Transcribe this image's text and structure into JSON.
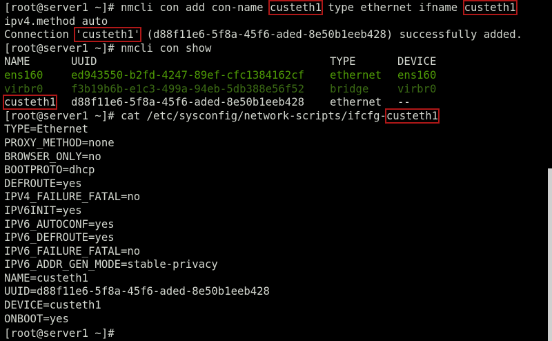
{
  "prompt": "[root@server1 ~]#",
  "cmd1": {
    "pre": " nmcli con add con-name ",
    "arg1": "custeth1",
    "mid": " type ethernet ifname ",
    "arg2": "custeth1",
    "cont": "ipv4.method auto"
  },
  "result1": {
    "pre": "Connection ",
    "name": "'custeth1'",
    "post": " (d88f11e6-5f8a-45f6-aded-8e50b1eeb428) successfully added."
  },
  "cmd2": " nmcli con show",
  "table": {
    "headers": [
      "NAME",
      "UUID",
      "TYPE",
      "DEVICE"
    ],
    "rows": [
      {
        "name": "ens160",
        "uuid": "ed943550-b2fd-4247-89ef-cfc1384162cf",
        "type": "ethernet",
        "device": "ens160"
      },
      {
        "name": "virbr0",
        "uuid": "f3b19b6b-e1c3-499a-94eb-5db388e56f52",
        "type": "bridge",
        "device": "virbr0"
      },
      {
        "name": "custeth1",
        "uuid": "d88f11e6-5f8a-45f6-aded-8e50b1eeb428",
        "type": "ethernet",
        "device": "--"
      }
    ]
  },
  "cmd3": {
    "pre": " cat /etc/sysconfig/network-scripts/ifcfg-",
    "arg": "custeth1"
  },
  "ifcfg": [
    "TYPE=Ethernet",
    "PROXY_METHOD=none",
    "BROWSER_ONLY=no",
    "BOOTPROTO=dhcp",
    "DEFROUTE=yes",
    "IPV4_FAILURE_FATAL=no",
    "IPV6INIT=yes",
    "IPV6_AUTOCONF=yes",
    "IPV6_DEFROUTE=yes",
    "IPV6_FAILURE_FATAL=no",
    "IPV6_ADDR_GEN_MODE=stable-privacy",
    "NAME=custeth1",
    "UUID=d88f11e6-5f8a-45f6-aded-8e50b1eeb428",
    "DEVICE=custeth1",
    "ONBOOT=yes"
  ],
  "colors": {
    "background": "#000000",
    "text": "#d3d7cf",
    "active_green": "#4e9a06",
    "inactive_green": "#3b6b14",
    "highlight_box": "#b01818"
  }
}
